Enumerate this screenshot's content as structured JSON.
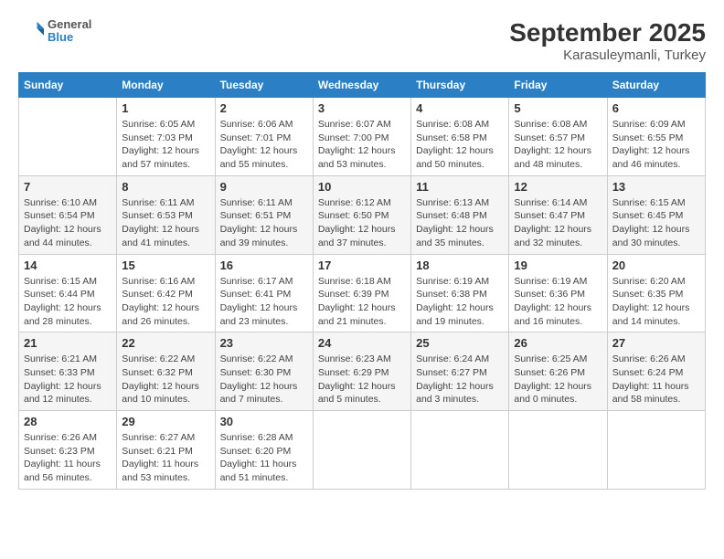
{
  "logo": {
    "line1": "General",
    "line2": "Blue"
  },
  "title": "September 2025",
  "subtitle": "Karasuleymanli, Turkey",
  "days_of_week": [
    "Sunday",
    "Monday",
    "Tuesday",
    "Wednesday",
    "Thursday",
    "Friday",
    "Saturday"
  ],
  "weeks": [
    [
      {
        "day": "",
        "detail": ""
      },
      {
        "day": "1",
        "detail": "Sunrise: 6:05 AM\nSunset: 7:03 PM\nDaylight: 12 hours\nand 57 minutes."
      },
      {
        "day": "2",
        "detail": "Sunrise: 6:06 AM\nSunset: 7:01 PM\nDaylight: 12 hours\nand 55 minutes."
      },
      {
        "day": "3",
        "detail": "Sunrise: 6:07 AM\nSunset: 7:00 PM\nDaylight: 12 hours\nand 53 minutes."
      },
      {
        "day": "4",
        "detail": "Sunrise: 6:08 AM\nSunset: 6:58 PM\nDaylight: 12 hours\nand 50 minutes."
      },
      {
        "day": "5",
        "detail": "Sunrise: 6:08 AM\nSunset: 6:57 PM\nDaylight: 12 hours\nand 48 minutes."
      },
      {
        "day": "6",
        "detail": "Sunrise: 6:09 AM\nSunset: 6:55 PM\nDaylight: 12 hours\nand 46 minutes."
      }
    ],
    [
      {
        "day": "7",
        "detail": "Sunrise: 6:10 AM\nSunset: 6:54 PM\nDaylight: 12 hours\nand 44 minutes."
      },
      {
        "day": "8",
        "detail": "Sunrise: 6:11 AM\nSunset: 6:53 PM\nDaylight: 12 hours\nand 41 minutes."
      },
      {
        "day": "9",
        "detail": "Sunrise: 6:11 AM\nSunset: 6:51 PM\nDaylight: 12 hours\nand 39 minutes."
      },
      {
        "day": "10",
        "detail": "Sunrise: 6:12 AM\nSunset: 6:50 PM\nDaylight: 12 hours\nand 37 minutes."
      },
      {
        "day": "11",
        "detail": "Sunrise: 6:13 AM\nSunset: 6:48 PM\nDaylight: 12 hours\nand 35 minutes."
      },
      {
        "day": "12",
        "detail": "Sunrise: 6:14 AM\nSunset: 6:47 PM\nDaylight: 12 hours\nand 32 minutes."
      },
      {
        "day": "13",
        "detail": "Sunrise: 6:15 AM\nSunset: 6:45 PM\nDaylight: 12 hours\nand 30 minutes."
      }
    ],
    [
      {
        "day": "14",
        "detail": "Sunrise: 6:15 AM\nSunset: 6:44 PM\nDaylight: 12 hours\nand 28 minutes."
      },
      {
        "day": "15",
        "detail": "Sunrise: 6:16 AM\nSunset: 6:42 PM\nDaylight: 12 hours\nand 26 minutes."
      },
      {
        "day": "16",
        "detail": "Sunrise: 6:17 AM\nSunset: 6:41 PM\nDaylight: 12 hours\nand 23 minutes."
      },
      {
        "day": "17",
        "detail": "Sunrise: 6:18 AM\nSunset: 6:39 PM\nDaylight: 12 hours\nand 21 minutes."
      },
      {
        "day": "18",
        "detail": "Sunrise: 6:19 AM\nSunset: 6:38 PM\nDaylight: 12 hours\nand 19 minutes."
      },
      {
        "day": "19",
        "detail": "Sunrise: 6:19 AM\nSunset: 6:36 PM\nDaylight: 12 hours\nand 16 minutes."
      },
      {
        "day": "20",
        "detail": "Sunrise: 6:20 AM\nSunset: 6:35 PM\nDaylight: 12 hours\nand 14 minutes."
      }
    ],
    [
      {
        "day": "21",
        "detail": "Sunrise: 6:21 AM\nSunset: 6:33 PM\nDaylight: 12 hours\nand 12 minutes."
      },
      {
        "day": "22",
        "detail": "Sunrise: 6:22 AM\nSunset: 6:32 PM\nDaylight: 12 hours\nand 10 minutes."
      },
      {
        "day": "23",
        "detail": "Sunrise: 6:22 AM\nSunset: 6:30 PM\nDaylight: 12 hours\nand 7 minutes."
      },
      {
        "day": "24",
        "detail": "Sunrise: 6:23 AM\nSunset: 6:29 PM\nDaylight: 12 hours\nand 5 minutes."
      },
      {
        "day": "25",
        "detail": "Sunrise: 6:24 AM\nSunset: 6:27 PM\nDaylight: 12 hours\nand 3 minutes."
      },
      {
        "day": "26",
        "detail": "Sunrise: 6:25 AM\nSunset: 6:26 PM\nDaylight: 12 hours\nand 0 minutes."
      },
      {
        "day": "27",
        "detail": "Sunrise: 6:26 AM\nSunset: 6:24 PM\nDaylight: 11 hours\nand 58 minutes."
      }
    ],
    [
      {
        "day": "28",
        "detail": "Sunrise: 6:26 AM\nSunset: 6:23 PM\nDaylight: 11 hours\nand 56 minutes."
      },
      {
        "day": "29",
        "detail": "Sunrise: 6:27 AM\nSunset: 6:21 PM\nDaylight: 11 hours\nand 53 minutes."
      },
      {
        "day": "30",
        "detail": "Sunrise: 6:28 AM\nSunset: 6:20 PM\nDaylight: 11 hours\nand 51 minutes."
      },
      {
        "day": "",
        "detail": ""
      },
      {
        "day": "",
        "detail": ""
      },
      {
        "day": "",
        "detail": ""
      },
      {
        "day": "",
        "detail": ""
      }
    ]
  ]
}
